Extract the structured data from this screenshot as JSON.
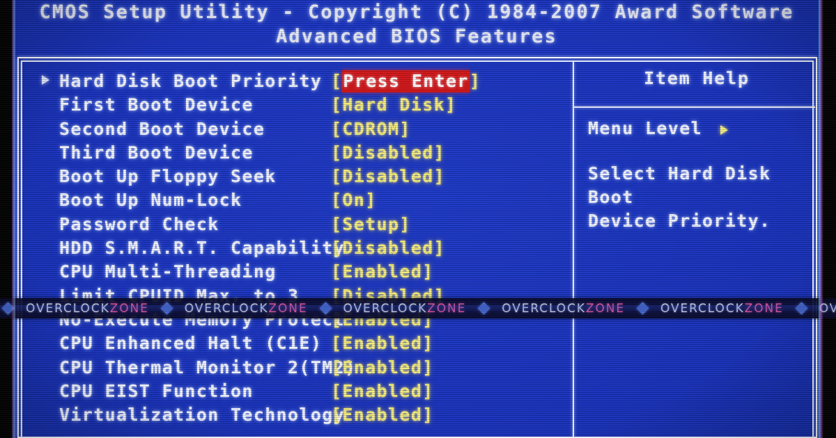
{
  "header": {
    "title": "CMOS Setup Utility - Copyright (C) 1984-2007 Award Software",
    "subtitle": "Advanced BIOS Features"
  },
  "colors": {
    "screen_blue": "#1730bb",
    "text_white": "#f0f2ff",
    "value_yellow": "#f2ea7a",
    "highlight_red": "#cf1417",
    "highlight_text": "#ffffff",
    "watermark_pink": "#e0569f"
  },
  "options": [
    {
      "label": "Hard Disk Boot Priority",
      "value": "Press Enter",
      "selected": true
    },
    {
      "label": "First Boot Device",
      "value": "Hard Disk",
      "selected": false
    },
    {
      "label": "Second Boot Device",
      "value": "CDROM",
      "selected": false
    },
    {
      "label": "Third Boot Device",
      "value": "Disabled",
      "selected": false
    },
    {
      "label": "Boot Up Floppy Seek",
      "value": "Disabled",
      "selected": false
    },
    {
      "label": "Boot Up Num-Lock",
      "value": "On",
      "selected": false
    },
    {
      "label": "Password Check",
      "value": "Setup",
      "selected": false
    },
    {
      "label": "HDD S.M.A.R.T. Capability",
      "value": "Disabled",
      "selected": false
    },
    {
      "label": "CPU Multi-Threading",
      "value": "Enabled",
      "selected": false
    },
    {
      "label": "Limit CPUID Max. to 3",
      "value": "Disabled",
      "selected": false
    },
    {
      "label": "No-Execute Memory Protect",
      "value": "Enabled",
      "selected": false
    },
    {
      "label": "CPU Enhanced Halt (C1E)",
      "value": "Enabled",
      "selected": false
    },
    {
      "label": "CPU Thermal Monitor 2(TM2)",
      "value": "Enabled",
      "selected": false
    },
    {
      "label": "CPU EIST Function",
      "value": "Enabled",
      "selected": false
    },
    {
      "label": "Virtualization Technology",
      "value": "Enabled",
      "selected": false
    }
  ],
  "item_help": {
    "title": "Item Help",
    "menu_level_label": "Menu Level",
    "menu_level_arrow": "right-triangle-icon",
    "description": "Select Hard Disk Boot\nDevice Priority."
  },
  "watermark": {
    "text_primary": "OVERCLOCK",
    "text_secondary": "ZONE",
    "separator": "diamond-icon",
    "repeat_count": 7
  }
}
